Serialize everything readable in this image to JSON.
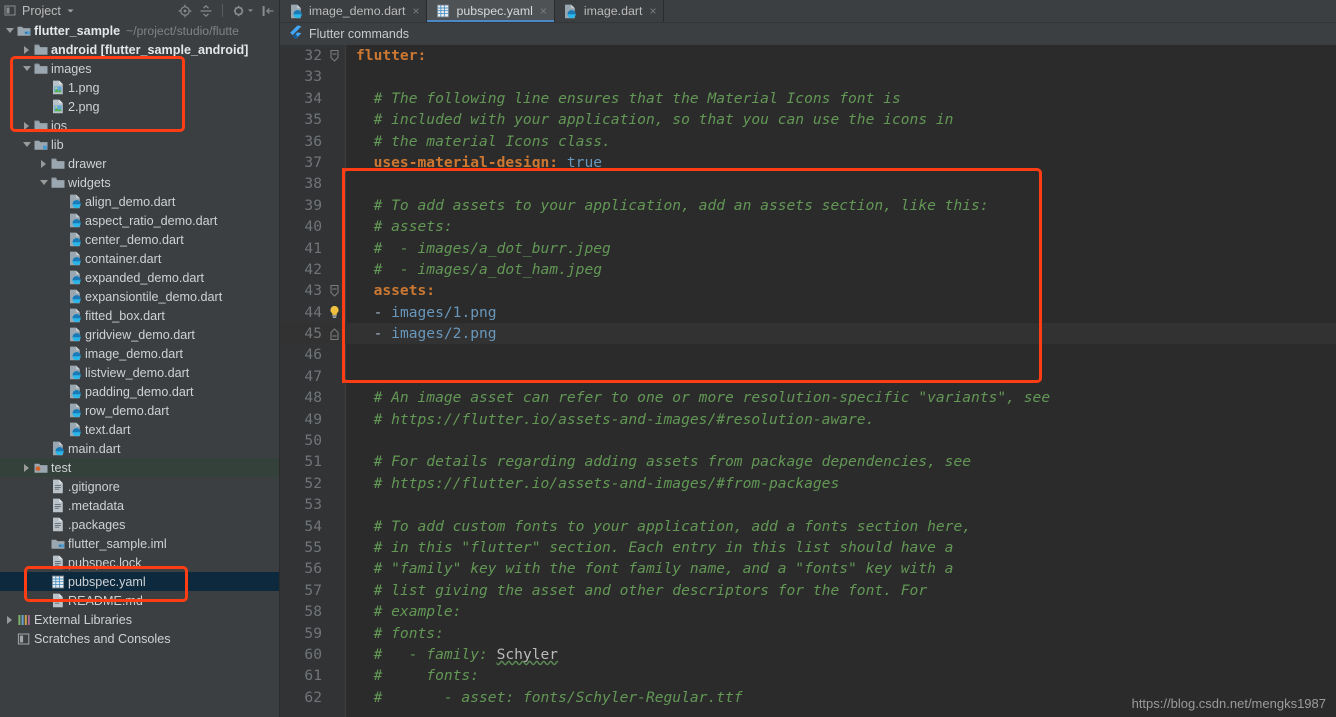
{
  "panel": {
    "title": "Project",
    "dropdown_icon": "chevron-down-icon",
    "tools": [
      "locate-icon",
      "collapse-all-icon",
      "settings-gear-icon",
      "hide-panel-icon"
    ]
  },
  "tree": [
    {
      "label": "flutter_sample",
      "sub": "~/project/studio/flutte",
      "icon": "module-icon",
      "indent": 0,
      "arrow": "open",
      "bold": true,
      "state": "normal"
    },
    {
      "label": "android [flutter_sample_android]",
      "sub": "",
      "icon": "folder-icon",
      "indent": 1,
      "arrow": "closed",
      "bold": true,
      "state": "normal"
    },
    {
      "label": "images",
      "sub": "",
      "icon": "folder-icon",
      "indent": 1,
      "arrow": "open",
      "bold": false,
      "state": "normal"
    },
    {
      "label": "1.png",
      "sub": "",
      "icon": "image-file-icon",
      "indent": 2,
      "arrow": "none",
      "bold": false,
      "state": "normal"
    },
    {
      "label": "2.png",
      "sub": "",
      "icon": "image-file-icon",
      "indent": 2,
      "arrow": "none",
      "bold": false,
      "state": "normal"
    },
    {
      "label": "ios",
      "sub": "",
      "icon": "folder-icon",
      "indent": 1,
      "arrow": "closed",
      "bold": false,
      "state": "normal"
    },
    {
      "label": "lib",
      "sub": "",
      "icon": "folder-src-icon",
      "indent": 1,
      "arrow": "open",
      "bold": false,
      "state": "normal"
    },
    {
      "label": "drawer",
      "sub": "",
      "icon": "folder-icon",
      "indent": 2,
      "arrow": "closed",
      "bold": false,
      "state": "normal"
    },
    {
      "label": "widgets",
      "sub": "",
      "icon": "folder-icon",
      "indent": 2,
      "arrow": "open",
      "bold": false,
      "state": "normal"
    },
    {
      "label": "align_demo.dart",
      "sub": "",
      "icon": "dart-file-icon",
      "indent": 3,
      "arrow": "none",
      "bold": false,
      "state": "normal"
    },
    {
      "label": "aspect_ratio_demo.dart",
      "sub": "",
      "icon": "dart-file-icon",
      "indent": 3,
      "arrow": "none",
      "bold": false,
      "state": "normal"
    },
    {
      "label": "center_demo.dart",
      "sub": "",
      "icon": "dart-file-icon",
      "indent": 3,
      "arrow": "none",
      "bold": false,
      "state": "normal"
    },
    {
      "label": "container.dart",
      "sub": "",
      "icon": "dart-file-icon",
      "indent": 3,
      "arrow": "none",
      "bold": false,
      "state": "normal"
    },
    {
      "label": "expanded_demo.dart",
      "sub": "",
      "icon": "dart-file-icon",
      "indent": 3,
      "arrow": "none",
      "bold": false,
      "state": "normal"
    },
    {
      "label": "expansiontile_demo.dart",
      "sub": "",
      "icon": "dart-file-icon",
      "indent": 3,
      "arrow": "none",
      "bold": false,
      "state": "normal"
    },
    {
      "label": "fitted_box.dart",
      "sub": "",
      "icon": "dart-file-icon",
      "indent": 3,
      "arrow": "none",
      "bold": false,
      "state": "normal"
    },
    {
      "label": "gridview_demo.dart",
      "sub": "",
      "icon": "dart-file-icon",
      "indent": 3,
      "arrow": "none",
      "bold": false,
      "state": "normal"
    },
    {
      "label": "image_demo.dart",
      "sub": "",
      "icon": "dart-file-icon",
      "indent": 3,
      "arrow": "none",
      "bold": false,
      "state": "normal"
    },
    {
      "label": "listview_demo.dart",
      "sub": "",
      "icon": "dart-file-icon",
      "indent": 3,
      "arrow": "none",
      "bold": false,
      "state": "normal"
    },
    {
      "label": "padding_demo.dart",
      "sub": "",
      "icon": "dart-file-icon",
      "indent": 3,
      "arrow": "none",
      "bold": false,
      "state": "normal"
    },
    {
      "label": "row_demo.dart",
      "sub": "",
      "icon": "dart-file-icon",
      "indent": 3,
      "arrow": "none",
      "bold": false,
      "state": "normal"
    },
    {
      "label": "text.dart",
      "sub": "",
      "icon": "dart-file-icon",
      "indent": 3,
      "arrow": "none",
      "bold": false,
      "state": "normal"
    },
    {
      "label": "main.dart",
      "sub": "",
      "icon": "dart-file-icon",
      "indent": 2,
      "arrow": "none",
      "bold": false,
      "state": "normal"
    },
    {
      "label": "test",
      "sub": "",
      "icon": "folder-test-icon",
      "indent": 1,
      "arrow": "closed",
      "bold": false,
      "state": "hover"
    },
    {
      "label": ".gitignore",
      "sub": "",
      "icon": "text-file-icon",
      "indent": 2,
      "arrow": "none",
      "bold": false,
      "state": "normal"
    },
    {
      "label": ".metadata",
      "sub": "",
      "icon": "text-file-icon",
      "indent": 2,
      "arrow": "none",
      "bold": false,
      "state": "normal"
    },
    {
      "label": ".packages",
      "sub": "",
      "icon": "text-file-icon",
      "indent": 2,
      "arrow": "none",
      "bold": false,
      "state": "normal"
    },
    {
      "label": "flutter_sample.iml",
      "sub": "",
      "icon": "module-icon",
      "indent": 2,
      "arrow": "none",
      "bold": false,
      "state": "normal"
    },
    {
      "label": "pubspec.lock",
      "sub": "",
      "icon": "text-file-icon",
      "indent": 2,
      "arrow": "none",
      "bold": false,
      "state": "normal"
    },
    {
      "label": "pubspec.yaml",
      "sub": "",
      "icon": "yaml-file-icon",
      "indent": 2,
      "arrow": "none",
      "bold": false,
      "state": "selected"
    },
    {
      "label": "README.md",
      "sub": "",
      "icon": "text-file-icon",
      "indent": 2,
      "arrow": "none",
      "bold": false,
      "state": "normal"
    },
    {
      "label": "External Libraries",
      "sub": "",
      "icon": "libraries-icon",
      "indent": 0,
      "arrow": "closed",
      "bold": false,
      "state": "normal"
    },
    {
      "label": "Scratches and Consoles",
      "sub": "",
      "icon": "scratches-icon",
      "indent": 0,
      "arrow": "none",
      "bold": false,
      "state": "normal"
    }
  ],
  "tabs": [
    {
      "label": "image_demo.dart",
      "icon": "dart-file-icon",
      "active": false,
      "close": "×"
    },
    {
      "label": "pubspec.yaml",
      "icon": "yaml-file-icon",
      "active": true,
      "close": "×"
    },
    {
      "label": "image.dart",
      "icon": "dart-file-icon",
      "active": false,
      "close": "×"
    }
  ],
  "command_bar": {
    "label": "Flutter commands",
    "icon": "flutter-logo-icon"
  },
  "editor": {
    "first_line": 32,
    "current_line": 45,
    "lightbulb_line": 44,
    "lines": [
      {
        "n": 32,
        "fold": "fold-start",
        "tokens": [
          {
            "t": "key",
            "s": "flutter:"
          }
        ]
      },
      {
        "n": 33,
        "fold": "",
        "tokens": []
      },
      {
        "n": 34,
        "fold": "",
        "tokens": [
          {
            "t": "cmt",
            "s": "  # The following line ensures that the Material Icons font is"
          }
        ]
      },
      {
        "n": 35,
        "fold": "",
        "tokens": [
          {
            "t": "cmt",
            "s": "  # included with your application, so that you can use the icons in"
          }
        ]
      },
      {
        "n": 36,
        "fold": "",
        "tokens": [
          {
            "t": "cmt",
            "s": "  # the material Icons class."
          }
        ]
      },
      {
        "n": 37,
        "fold": "",
        "tokens": [
          {
            "t": "key",
            "s": "  uses-material-design: "
          },
          {
            "t": "val",
            "s": "true"
          }
        ]
      },
      {
        "n": 38,
        "fold": "",
        "tokens": []
      },
      {
        "n": 39,
        "fold": "",
        "tokens": [
          {
            "t": "cmt",
            "s": "  # To add assets to your application, add an assets section, like this:"
          }
        ]
      },
      {
        "n": 40,
        "fold": "",
        "tokens": [
          {
            "t": "cmt",
            "s": "  # assets:"
          }
        ]
      },
      {
        "n": 41,
        "fold": "",
        "tokens": [
          {
            "t": "cmt",
            "s": "  #  - images/a_dot_burr.jpeg"
          }
        ]
      },
      {
        "n": 42,
        "fold": "",
        "tokens": [
          {
            "t": "cmt",
            "s": "  #  - images/a_dot_ham.jpeg"
          }
        ]
      },
      {
        "n": 43,
        "fold": "fold-start",
        "tokens": [
          {
            "t": "key",
            "s": "  assets:"
          }
        ]
      },
      {
        "n": 44,
        "fold": "",
        "tokens": [
          {
            "t": "dash",
            "s": "  - "
          },
          {
            "t": "val",
            "s": "images/1.png"
          }
        ]
      },
      {
        "n": 45,
        "fold": "fold-end",
        "tokens": [
          {
            "t": "dash",
            "s": "  - "
          },
          {
            "t": "val",
            "s": "images/2.png"
          }
        ]
      },
      {
        "n": 46,
        "fold": "",
        "tokens": []
      },
      {
        "n": 47,
        "fold": "",
        "tokens": []
      },
      {
        "n": 48,
        "fold": "",
        "tokens": [
          {
            "t": "cmt",
            "s": "  # An image asset can refer to one or more resolution-specific \"variants\", see"
          }
        ]
      },
      {
        "n": 49,
        "fold": "",
        "tokens": [
          {
            "t": "cmt",
            "s": "  # https://flutter.io/assets-and-images/#resolution-aware."
          }
        ]
      },
      {
        "n": 50,
        "fold": "",
        "tokens": []
      },
      {
        "n": 51,
        "fold": "",
        "tokens": [
          {
            "t": "cmt",
            "s": "  # For details regarding adding assets from package dependencies, see"
          }
        ]
      },
      {
        "n": 52,
        "fold": "",
        "tokens": [
          {
            "t": "cmt",
            "s": "  # https://flutter.io/assets-and-images/#from-packages"
          }
        ]
      },
      {
        "n": 53,
        "fold": "",
        "tokens": []
      },
      {
        "n": 54,
        "fold": "",
        "tokens": [
          {
            "t": "cmt",
            "s": "  # To add custom fonts to your application, add a fonts section here,"
          }
        ]
      },
      {
        "n": 55,
        "fold": "",
        "tokens": [
          {
            "t": "cmt",
            "s": "  # in this \"flutter\" section. Each entry in this list should have a"
          }
        ]
      },
      {
        "n": 56,
        "fold": "",
        "tokens": [
          {
            "t": "cmt",
            "s": "  # \"family\" key with the font family name, and a \"fonts\" key with a"
          }
        ]
      },
      {
        "n": 57,
        "fold": "",
        "tokens": [
          {
            "t": "cmt",
            "s": "  # list giving the asset and other descriptors for the font. For"
          }
        ]
      },
      {
        "n": 58,
        "fold": "",
        "tokens": [
          {
            "t": "cmt",
            "s": "  # example:"
          }
        ]
      },
      {
        "n": 59,
        "fold": "",
        "tokens": [
          {
            "t": "cmt",
            "s": "  # fonts:"
          }
        ]
      },
      {
        "n": 60,
        "fold": "",
        "tokens": [
          {
            "t": "cmt",
            "s": "  #   - family: "
          },
          {
            "t": "typo",
            "s": "Schyler"
          }
        ]
      },
      {
        "n": 61,
        "fold": "",
        "tokens": [
          {
            "t": "cmt",
            "s": "  #     fonts:"
          }
        ]
      },
      {
        "n": 62,
        "fold": "",
        "tokens": [
          {
            "t": "cmt",
            "s": "  #       - asset: fonts/Schyler-Regular.ttf"
          }
        ]
      }
    ]
  },
  "watermark": "https://blog.csdn.net/mengks1987",
  "colors": {
    "annotation_red": "#ff3d14",
    "comment_green": "#629755",
    "key_orange": "#cc7832",
    "value_blue": "#6897bb",
    "selection_blue": "#0d293e",
    "tab_accent": "#4a88c7"
  }
}
